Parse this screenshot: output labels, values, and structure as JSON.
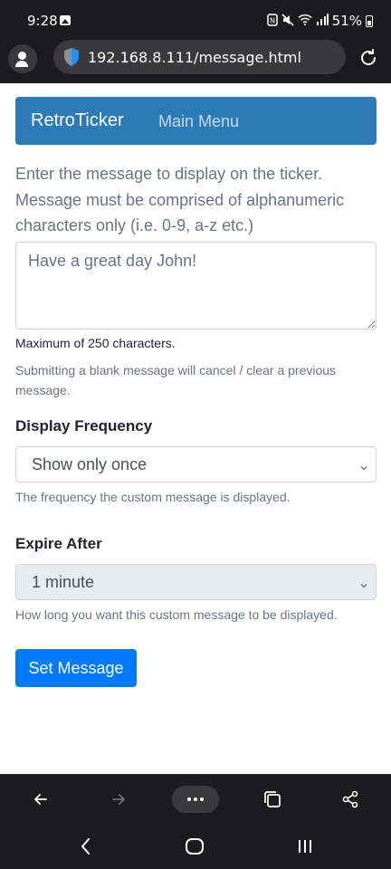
{
  "status_bar": {
    "time": "9:28",
    "battery_pct": "51%",
    "icons": [
      "gallery-icon",
      "nfc-icon",
      "mute-icon",
      "wifi-icon",
      "signal-icon",
      "battery-icon"
    ]
  },
  "browser": {
    "url": "192.168.8.111/message.html",
    "icons": [
      "profile-icon",
      "shield-icon",
      "reload-icon"
    ]
  },
  "navbar": {
    "brand": "RetroTicker",
    "menu_link": "Main Menu",
    "color": "#2c7bb6"
  },
  "form": {
    "intro": "Enter the message to display on the ticker. Message must be comprised of alphanumeric characters only (i.e. 0-9, a-z etc.)",
    "message_value": "Have a great day John!",
    "max_chars_note": "Maximum of 250 characters.",
    "blank_note": "Submitting a blank message will cancel / clear a previous message.",
    "frequency": {
      "label": "Display Frequency",
      "selected": "Show only once",
      "help": "The frequency the custom message is displayed."
    },
    "expire": {
      "label": "Expire After",
      "selected": "1 minute",
      "help": "How long you want this custom message to be displayed."
    },
    "submit_label": "Set Message",
    "submit_color": "#007bff"
  },
  "bottom_toolbar": {
    "items": [
      "back-arrow-icon",
      "forward-arrow-icon",
      "more-icon",
      "tabs-icon",
      "share-icon"
    ]
  },
  "nav_bar": {
    "items": [
      "nav-back-icon",
      "home-icon",
      "recents-icon"
    ]
  }
}
